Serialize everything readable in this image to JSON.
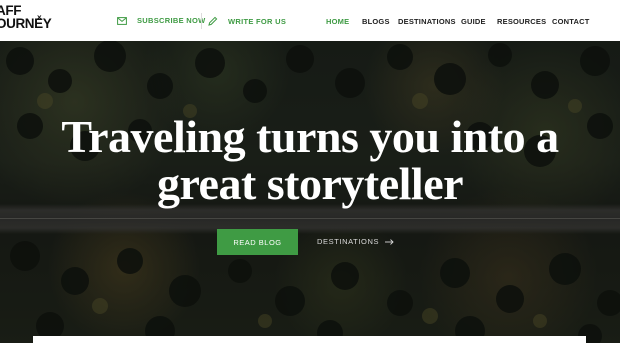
{
  "logo": {
    "line1": "AFF",
    "line2": "OURNEY",
    "mark": "×"
  },
  "utility": {
    "subscribe": {
      "label": "SUBSCRIBE NOW",
      "icon": "mail-icon"
    },
    "write": {
      "label": "WRITE FOR US",
      "icon": "pencil-icon"
    }
  },
  "nav": {
    "items": [
      {
        "label": "HOME",
        "active": true
      },
      {
        "label": "BLOGS",
        "active": false
      },
      {
        "label": "DESTINATIONS",
        "active": false
      },
      {
        "label": "GUIDE",
        "active": false
      },
      {
        "label": "RESOURCES",
        "active": false
      },
      {
        "label": "CONTACT",
        "active": false
      }
    ]
  },
  "hero": {
    "headline_line1": "Traveling turns you into a",
    "headline_line2": "great storyteller",
    "primary_button": "READ BLOG",
    "secondary_link": "DESTINATIONS",
    "secondary_icon": "arrow-right-icon"
  },
  "colors": {
    "accent": "#3f9b44",
    "header_bg": "#ffffff",
    "text_dark": "#222222"
  }
}
